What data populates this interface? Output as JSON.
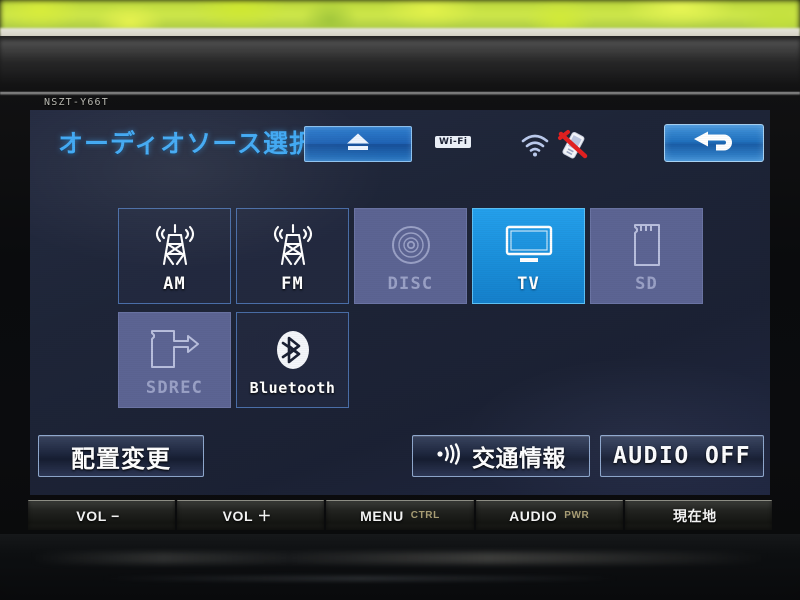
{
  "device": {
    "model_badge": "NSZT-Y66T"
  },
  "screen": {
    "title": "オーディオソース選択",
    "status": {
      "wifi_badge": "Wi-Fi",
      "wifi_icon": "wifi-signal-icon",
      "phone_icon": "phone-disconnected-icon",
      "eject_icon": "eject-icon",
      "back_icon": "back-arrow-icon"
    },
    "sources": [
      {
        "id": "am",
        "label": "AM",
        "icon": "radio-tower-icon",
        "state": "enabled"
      },
      {
        "id": "fm",
        "label": "FM",
        "icon": "radio-tower-icon",
        "state": "enabled"
      },
      {
        "id": "disc",
        "label": "DISC",
        "icon": "disc-icon",
        "state": "disabled"
      },
      {
        "id": "tv",
        "label": "TV",
        "icon": "tv-icon",
        "state": "selected"
      },
      {
        "id": "sd",
        "label": "SD",
        "icon": "sd-card-icon",
        "state": "disabled"
      },
      {
        "id": "sdrec",
        "label": "SDREC",
        "icon": "sd-record-icon",
        "state": "disabled"
      },
      {
        "id": "bluetooth",
        "label": "Bluetooth",
        "icon": "bluetooth-icon",
        "state": "enabled"
      }
    ],
    "bottom_buttons": {
      "rearrange": "配置変更",
      "traffic": "交通情報",
      "traffic_icon": "speaker-wave-icon",
      "audio_off": "AUDIO OFF"
    }
  },
  "hardkeys": [
    {
      "main": "VOL −",
      "sub": ""
    },
    {
      "main": "VOL ＋",
      "sub": ""
    },
    {
      "main": "MENU",
      "sub": "CTRL"
    },
    {
      "main": "AUDIO",
      "sub": "PWR"
    },
    {
      "main": "現在地",
      "sub": ""
    }
  ],
  "colors": {
    "accent_selected": "#1a8fda",
    "title_blue": "#3fa9f5",
    "screen_bg": "#1e2538",
    "disabled_tile": "#5c6493"
  }
}
